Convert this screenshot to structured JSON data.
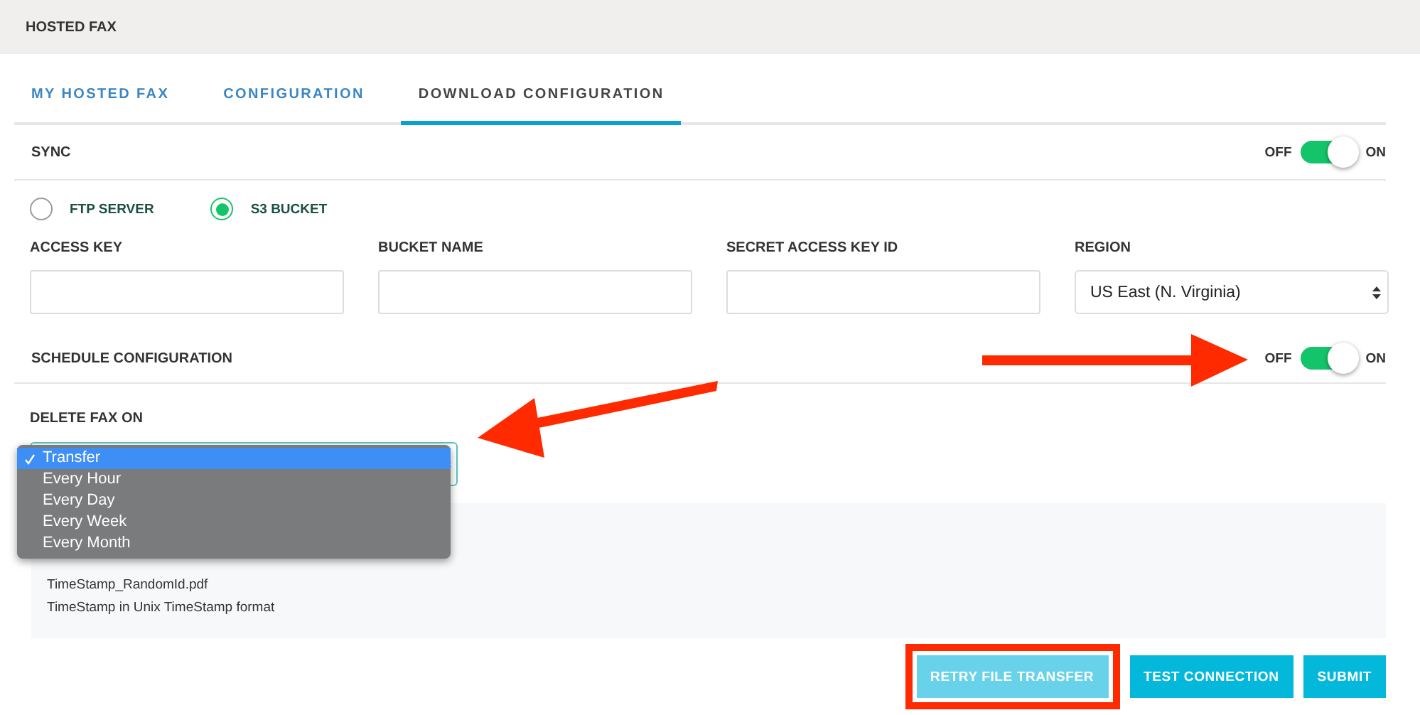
{
  "header": {
    "title": "HOSTED FAX"
  },
  "tabs": [
    {
      "label": "MY HOSTED FAX",
      "selected": false
    },
    {
      "label": "CONFIGURATION",
      "selected": false
    },
    {
      "label": "DOWNLOAD CONFIGURATION",
      "selected": true
    }
  ],
  "sync": {
    "label": "SYNC",
    "off_label": "OFF",
    "on_label": "ON",
    "on": true
  },
  "destinations": [
    {
      "label": "FTP SERVER",
      "selected": false
    },
    {
      "label": "S3 BUCKET",
      "selected": true
    }
  ],
  "fields": [
    {
      "label": "ACCESS KEY",
      "kind": "input"
    },
    {
      "label": "BUCKET NAME",
      "kind": "input"
    },
    {
      "label": "SECRET ACCESS KEY ID",
      "kind": "input"
    },
    {
      "label": "REGION",
      "kind": "select",
      "value": "US East (N. Virginia)"
    }
  ],
  "schedule": {
    "label": "SCHEDULE CONFIGURATION",
    "off_label": "OFF",
    "on_label": "ON",
    "on": true
  },
  "delete_fax_on": {
    "label": "DELETE FAX ON",
    "options": [
      {
        "label": "Transfer",
        "selected": true
      },
      {
        "label": "Every Hour",
        "selected": false
      },
      {
        "label": "Every Day",
        "selected": false
      },
      {
        "label": "Every Week",
        "selected": false
      },
      {
        "label": "Every Month",
        "selected": false
      }
    ]
  },
  "info_lines": [
    "TimeStamp_RandomId.pdf",
    "TimeStamp in Unix TimeStamp format"
  ],
  "buttons": [
    {
      "label": "RETRY FILE TRANSFER",
      "highlighted": true
    },
    {
      "label": "TEST CONNECTION",
      "highlighted": false
    },
    {
      "label": "SUBMIT",
      "highlighted": false
    }
  ]
}
